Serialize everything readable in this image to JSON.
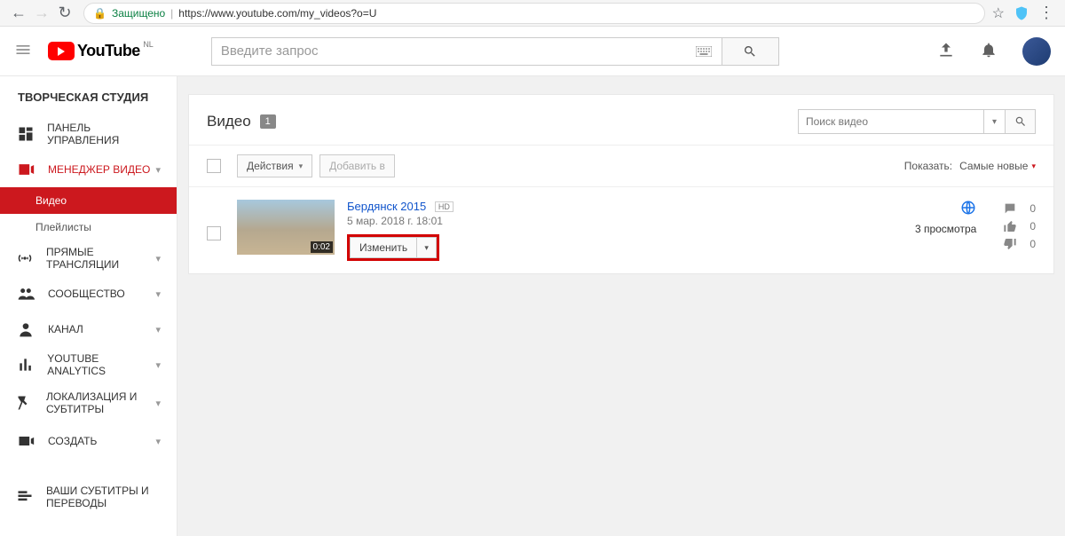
{
  "browser": {
    "secure_label": "Защищено",
    "url": "https://www.youtube.com/my_videos?o=U"
  },
  "header": {
    "brand": "YouTube",
    "region": "NL",
    "search_placeholder": "Введите запрос"
  },
  "sidebar": {
    "studio_title": "ТВОРЧЕСКАЯ СТУДИЯ",
    "items": [
      {
        "label": "ПАНЕЛЬ УПРАВЛЕНИЯ"
      },
      {
        "label": "МЕНЕДЖЕР ВИДЕО",
        "sub": [
          {
            "label": "Видео"
          },
          {
            "label": "Плейлисты"
          }
        ]
      },
      {
        "label": "ПРЯМЫЕ ТРАНСЛЯЦИИ"
      },
      {
        "label": "СООБЩЕСТВО"
      },
      {
        "label": "КАНАЛ"
      },
      {
        "label": "YOUTUBE ANALYTICS"
      },
      {
        "label": "ЛОКАЛИЗАЦИЯ И СУБТИТРЫ"
      },
      {
        "label": "СОЗДАТЬ"
      },
      {
        "label": "ВАШИ СУБТИТРЫ И ПЕРЕВОДЫ"
      }
    ]
  },
  "main": {
    "title": "Видео",
    "count": "1",
    "search_placeholder": "Поиск видео",
    "toolbar": {
      "actions_label": "Действия",
      "add_to_label": "Добавить в",
      "show_label": "Показать:",
      "sort_label": "Самые новые"
    },
    "video": {
      "title": "Бердянск 2015",
      "hd": "HD",
      "date": "5 мар. 2018 г. 18:01",
      "duration": "0:02",
      "edit_label": "Изменить",
      "views": "3 просмотра",
      "comments": "0",
      "likes": "0",
      "dislikes": "0"
    }
  }
}
